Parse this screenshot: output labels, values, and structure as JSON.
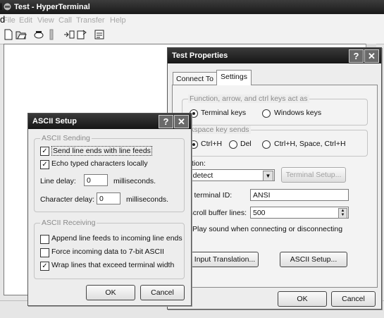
{
  "main_window": {
    "title": "Test - HyperTerminal",
    "menu": [
      "File",
      "Edit",
      "View",
      "Call",
      "Transfer",
      "Help"
    ],
    "toolbar_icons": [
      "new-icon",
      "open-icon",
      "connect-icon",
      "disconnect-icon",
      "send-icon",
      "receive-icon",
      "properties-icon"
    ]
  },
  "properties": {
    "title": "Test Properties",
    "help_btn": "?",
    "close_btn": "✕",
    "tabs": [
      "Connect To",
      "Settings"
    ],
    "func_group": "Function, arrow, and ctrl keys act as",
    "func_terminal": "Terminal keys",
    "func_windows": "Windows keys",
    "bksp_group": "ackspace key sends",
    "bksp_ctrlh": "Ctrl+H",
    "bksp_del": "Del",
    "bksp_ctrlh_space": "Ctrl+H, Space, Ctrl+H",
    "emulation_label": "ulation:",
    "emulation_value": "to detect",
    "terminal_setup": "Terminal Setup...",
    "telnet_label": "net terminal ID:",
    "telnet_value": "ANSI",
    "backscroll_label": "ckscroll buffer lines:",
    "backscroll_value": "500",
    "play_sound": "Play sound when connecting or disconnecting",
    "input_translation": "Input Translation...",
    "ascii_setup": "ASCII Setup...",
    "ok": "OK",
    "cancel": "Cancel"
  },
  "ascii": {
    "title": "ASCII Setup",
    "help_btn": "?",
    "close_btn": "✕",
    "sending_group": "ASCII Sending",
    "send_line_ends": "Send line ends with line feeds",
    "echo_typed": "Echo typed characters locally",
    "line_delay_label": "Line delay:",
    "line_delay_value": "0",
    "line_delay_units": "milliseconds.",
    "char_delay_label": "Character delay:",
    "char_delay_value": "0",
    "char_delay_units": "milliseconds.",
    "receiving_group": "ASCII Receiving",
    "append_line_feeds": "Append line feeds to incoming line ends",
    "force_7bit": "Force incoming data to 7-bit ASCII",
    "wrap_lines": "Wrap lines that exceed terminal width",
    "ok": "OK",
    "cancel": "Cancel"
  },
  "edge_text": [
    "l",
    "d"
  ]
}
